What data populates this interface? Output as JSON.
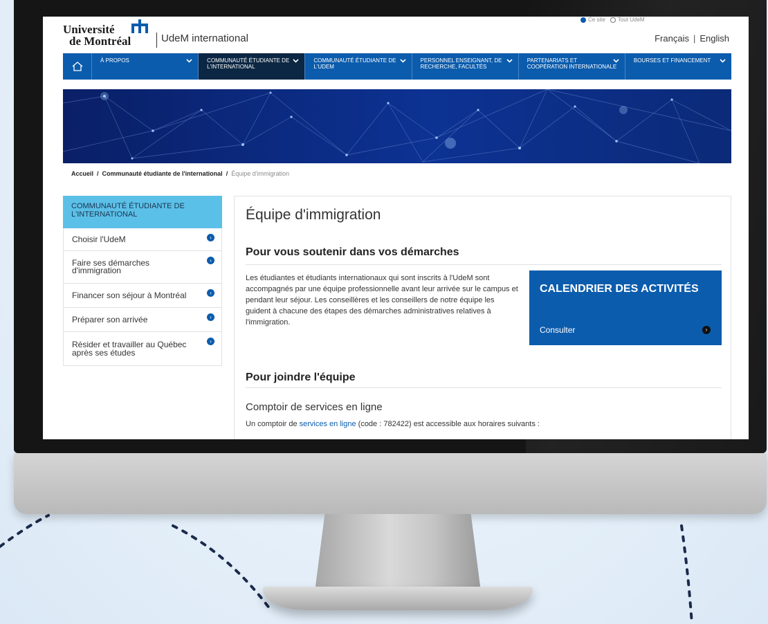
{
  "header": {
    "logo_line1": "Université",
    "logo_line2": "de Montréal",
    "site_name": "UdeM international",
    "search_scope": {
      "option1": "Ce site",
      "option2": "Tout UdeM"
    },
    "lang_fr": "Français",
    "lang_en": "English"
  },
  "nav": {
    "items": [
      {
        "label": "À PROPOS"
      },
      {
        "label": "COMMUNAUTÉ ÉTUDIANTE DE L'INTERNATIONAL"
      },
      {
        "label": "COMMUNAUTÉ ÉTUDIANTE DE L'UDEM"
      },
      {
        "label": "PERSONNEL ENSEIGNANT, DE RECHERCHE, FACULTÉS"
      },
      {
        "label": "PARTENARIATS ET COOPÉRATION INTERNATIONALE"
      },
      {
        "label": "BOURSES ET FINANCEMENT"
      }
    ]
  },
  "breadcrumb": {
    "items": [
      "Accueil",
      "Communauté étudiante de l'international"
    ],
    "current": "Équipe d'immigration"
  },
  "sidebar": {
    "heading": "COMMUNAUTÉ ÉTUDIANTE DE L'INTERNATIONAL",
    "items": [
      {
        "label": "Choisir l'UdeM"
      },
      {
        "label": "Faire ses démarches d'immigration"
      },
      {
        "label": "Financer son séjour à Montréal"
      },
      {
        "label": "Préparer son arrivée"
      },
      {
        "label": "Résider et travailler au Québec après ses études"
      }
    ]
  },
  "main": {
    "title": "Équipe d'immigration",
    "section1_heading": "Pour vous soutenir dans vos démarches",
    "section1_text": "Les étudiantes et étudiants internationaux qui sont inscrits à l'UdeM sont accompagnés par une équipe professionnelle avant leur arrivée sur le campus et pendant leur séjour. Les conseillères et les conseillers de notre équipe les guident à chacune des étapes des démarches administratives relatives à l'immigration.",
    "calendar_box": {
      "title": "CALENDRIER DES ACTIVITÉS",
      "link": "Consulter"
    },
    "section2_heading": "Pour joindre l'équipe",
    "subheading": "Comptoir de services en ligne",
    "services_text_before": "Un comptoir de",
    "services_link": "services en ligne",
    "services_text_after": "(code : 782422) est accessible aux horaires suivants :"
  },
  "colors": {
    "nav_blue": "#0b5cad",
    "nav_active": "#0c2743",
    "sidebar_head": "#5bc0e8",
    "banner_dark": "#0a1f66"
  }
}
